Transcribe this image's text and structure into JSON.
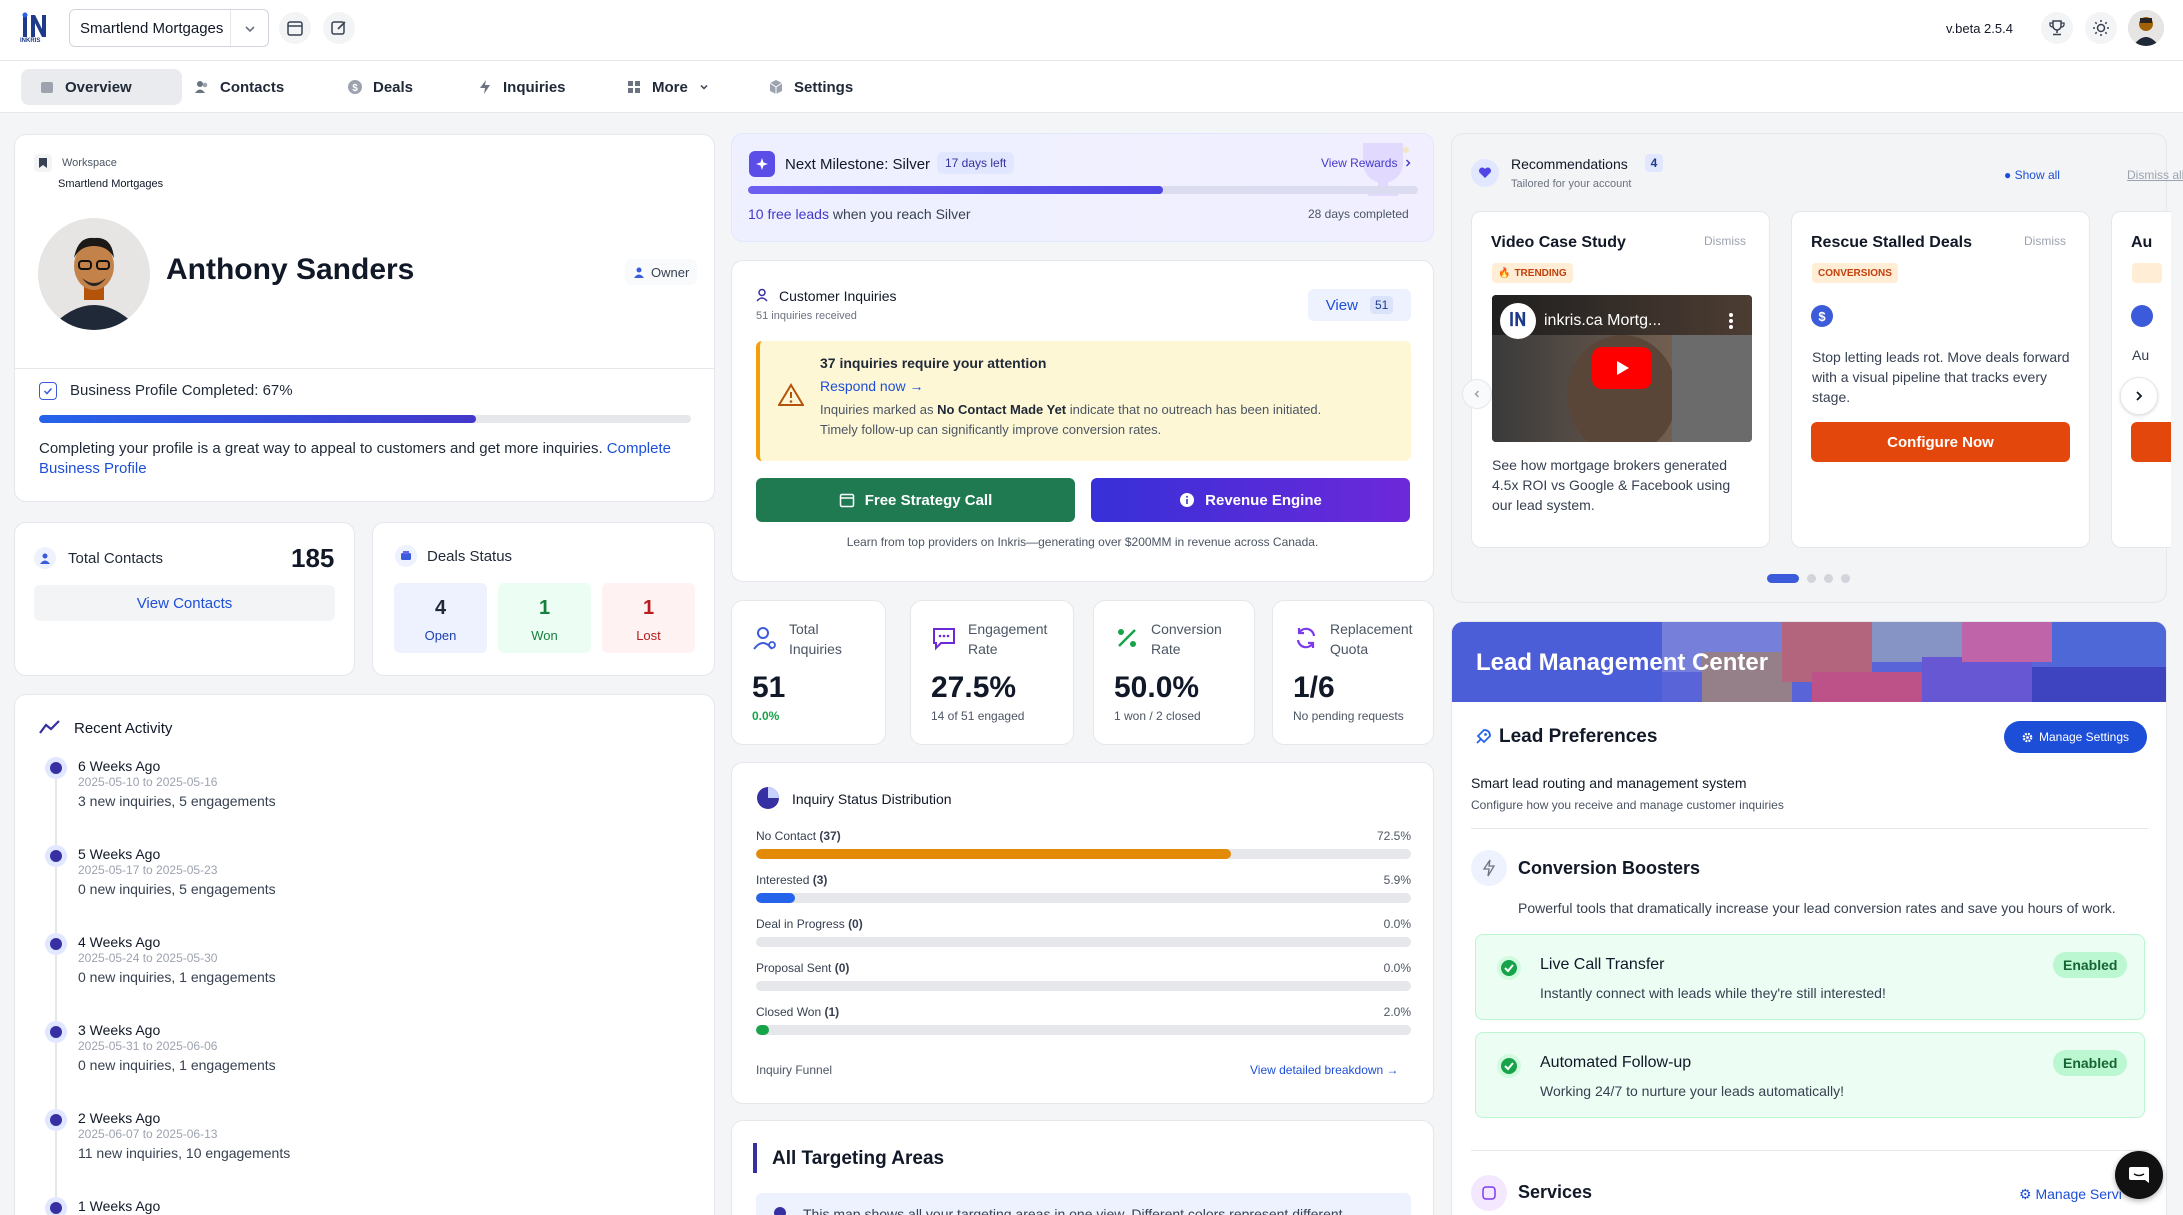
{
  "app": {
    "version": "v.beta 2.5.4",
    "logo_text": "INKRIS"
  },
  "workspace_select": {
    "value": "Smartlend Mortgages"
  },
  "nav": [
    {
      "label": "Overview",
      "icon": "home-icon"
    },
    {
      "label": "Contacts",
      "icon": "users-icon"
    },
    {
      "label": "Deals",
      "icon": "dollar-icon"
    },
    {
      "label": "Inquiries",
      "icon": "bolt-icon"
    },
    {
      "label": "More",
      "icon": "grid-icon"
    },
    {
      "label": "Settings",
      "icon": "cube-icon"
    }
  ],
  "profile": {
    "workspace_label": "Workspace",
    "workspace_name": "Smartlend Mortgages",
    "name": "Anthony Sanders",
    "role": "Owner",
    "completion_text": "Business Profile Completed: 67%",
    "completion": 0.67,
    "note": "Completing your profile is a great way to appeal to customers and get more inquiries.",
    "note_link_1": "Complete",
    "note_link_2": "Business Profile"
  },
  "contacts": {
    "title": "Total Contacts",
    "count": "185",
    "button": "View Contacts"
  },
  "deals": {
    "title": "Deals Status",
    "open": "4",
    "open_label": "Open",
    "won": "1",
    "won_label": "Won",
    "lost": "1",
    "lost_label": "Lost"
  },
  "activity": {
    "title": "Recent Activity",
    "items": [
      {
        "title": "6 Weeks Ago",
        "range": "2025-05-10 to 2025-05-16",
        "summary": "3 new inquiries, 5 engagements"
      },
      {
        "title": "5 Weeks Ago",
        "range": "2025-05-17 to 2025-05-23",
        "summary": "0 new inquiries, 5 engagements"
      },
      {
        "title": "4 Weeks Ago",
        "range": "2025-05-24 to 2025-05-30",
        "summary": "0 new inquiries, 1 engagements"
      },
      {
        "title": "3 Weeks Ago",
        "range": "2025-05-31 to 2025-06-06",
        "summary": "0 new inquiries, 1 engagements"
      },
      {
        "title": "2 Weeks Ago",
        "range": "2025-06-07 to 2025-06-13",
        "summary": "11 new inquiries, 10 engagements"
      },
      {
        "title": "1 Weeks Ago",
        "range": "",
        "summary": ""
      }
    ]
  },
  "milestone": {
    "label": "Next Milestone: Silver",
    "days_left": "17 days left",
    "rewards_link": "View Rewards",
    "progress": 0.62,
    "free_leads": "10 free leads",
    "free_leads_suffix": "when you reach Silver",
    "completed": "28 days completed"
  },
  "inquiries": {
    "title": "Customer Inquiries",
    "subtitle": "51 inquiries received",
    "view_label": "View",
    "view_count": "51",
    "alert_title": "37 inquiries require your attention",
    "alert_link": "Respond now →",
    "alert_text_1": "Inquiries marked as",
    "alert_text_bold": "No Contact Made Yet",
    "alert_text_2": "indicate that no outreach has been initiated.",
    "alert_text_3": "Timely follow-up can significantly improve conversion rates.",
    "btn_strategy": "Free Strategy Call",
    "btn_revenue": "Revenue Engine",
    "footer": "Learn from top providers on Inkris—generating over $200MM in revenue across Canada."
  },
  "stats": [
    {
      "label1": "Total",
      "label2": "Inquiries",
      "value": "51",
      "sub": "0.0%",
      "icon": "user-search-icon"
    },
    {
      "label1": "Engagement",
      "label2": "Rate",
      "value": "27.5%",
      "sub": "14 of 51 engaged",
      "icon": "chat-icon"
    },
    {
      "label1": "Conversion",
      "label2": "Rate",
      "value": "50.0%",
      "sub": "1 won / 2 closed",
      "icon": "percent-icon"
    },
    {
      "label1": "Replacement",
      "label2": "Quota",
      "value": "1/6",
      "sub": "No pending requests",
      "icon": "refresh-icon"
    }
  ],
  "distribution": {
    "title": "Inquiry Status Distribution",
    "rows": [
      {
        "label": "No Contact",
        "count": "(37)",
        "pct": "72.5%",
        "value": 0.725,
        "color": "#e38b06"
      },
      {
        "label": "Interested",
        "count": "(3)",
        "pct": "5.9%",
        "value": 0.059,
        "color": "#2563eb"
      },
      {
        "label": "Deal in Progress",
        "count": "(0)",
        "pct": "0.0%",
        "value": 0,
        "color": "#6b7280"
      },
      {
        "label": "Proposal Sent",
        "count": "(0)",
        "pct": "0.0%",
        "value": 0,
        "color": "#6b7280"
      },
      {
        "label": "Closed Won",
        "count": "(1)",
        "pct": "2.0%",
        "value": 0.02,
        "color": "#16a34a"
      }
    ],
    "funnel_label": "Inquiry Funnel",
    "breakdown_link": "View detailed breakdown →"
  },
  "targeting": {
    "title": "All Targeting Areas",
    "note": "This map shows all your targeting areas in one view. Different colors represent different"
  },
  "recommendations": {
    "title": "Recommendations",
    "count": "4",
    "subtitle": "Tailored for your account",
    "show_all": "Show all",
    "dismiss_all": "Dismiss all",
    "cards": [
      {
        "title": "Video Case Study",
        "dismiss": "Dismiss",
        "tag": "TRENDING",
        "video_title": "inkris.ca Mortg...",
        "text": "See how mortgage brokers generated 4.5x ROI vs Google & Facebook using our lead system."
      },
      {
        "title": "Rescue Stalled Deals",
        "dismiss": "Dismiss",
        "tag": "CONVERSIONS",
        "text": "Stop letting leads rot. Move deals forward with a visual pipeline that tracks every stage.",
        "button": "Configure Now"
      },
      {
        "title": "Au",
        "text": "Au"
      }
    ]
  },
  "lead_center": {
    "banner": "Lead Management Center",
    "prefs_title": "Lead Preferences",
    "manage_settings": "Manage Settings",
    "prefs_sub": "Smart lead routing and management system",
    "prefs_desc": "Configure how you receive and manage customer inquiries",
    "boosters_title": "Conversion Boosters",
    "boosters_desc": "Powerful tools that dramatically increase your lead conversion rates and save you hours of work.",
    "features": [
      {
        "title": "Live Call Transfer",
        "desc": "Instantly connect with leads while they're still interested!",
        "status": "Enabled"
      },
      {
        "title": "Automated Follow-up",
        "desc": "Working 24/7 to nurture your leads automatically!",
        "status": "Enabled"
      }
    ],
    "services_title": "Services",
    "manage_services": "Manage Servi"
  },
  "colors": {
    "primary": "#4f46e5",
    "green": "#1f7a52",
    "orange": "#e4470c",
    "purple": "#6d28d9"
  }
}
